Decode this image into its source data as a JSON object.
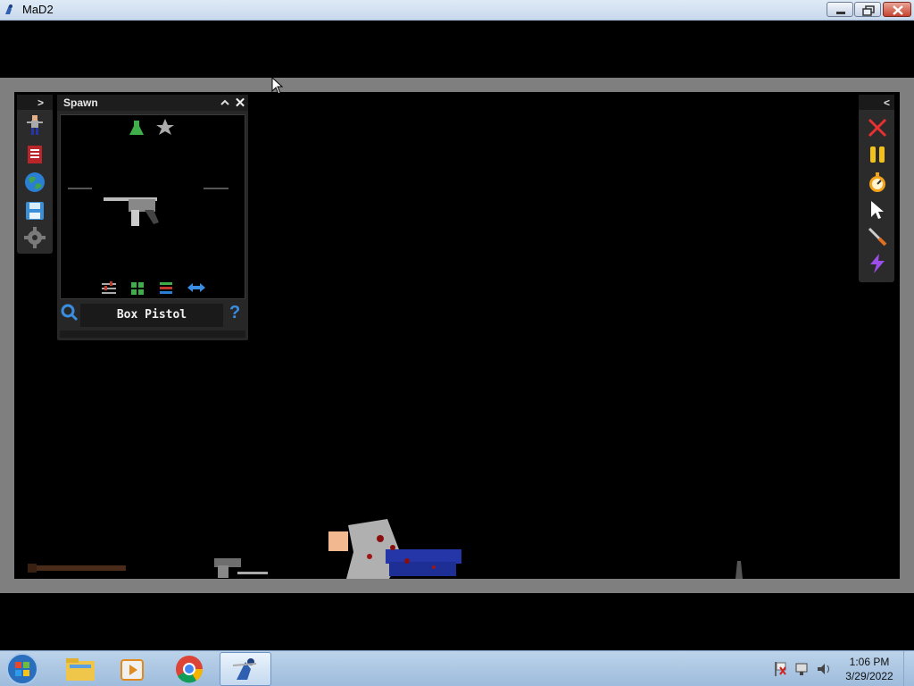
{
  "window": {
    "title": "MaD2",
    "controls": {
      "minimize": "minimize",
      "maximize": "restore",
      "close": "close"
    }
  },
  "left_toolbar": {
    "expand_label": ">",
    "items": [
      "spawn-ragdoll-icon",
      "spawn-menu-icon",
      "world-icon",
      "save-icon",
      "settings-gear-icon"
    ]
  },
  "spawn_panel": {
    "title": "Spawn",
    "collapse_label": "^",
    "close_label": "✕",
    "selected_item": "Box Pistol",
    "categories": [
      "flask-icon",
      "star-icon"
    ],
    "footer_tools": [
      "sliders-icon",
      "grid-icon",
      "list-icon",
      "swap-arrows-icon"
    ],
    "help_label": "?"
  },
  "right_toolbar": {
    "collapse_label": "<",
    "items": [
      "clear-x-icon",
      "pause-icon",
      "stopwatch-icon",
      "pointer-icon",
      "knife-tool-icon",
      "lightning-icon"
    ]
  },
  "taskbar": {
    "pinned": [
      "start-orb",
      "file-explorer-icon",
      "media-player-icon",
      "chrome-icon",
      "mad2-app-icon"
    ],
    "active": "mad2-app-icon",
    "tray": [
      "action-center-flag-icon",
      "network-icon",
      "volume-icon"
    ],
    "time": "1:06 PM",
    "date": "3/29/2022"
  },
  "colors": {
    "frame": "#7f7f7f",
    "panel": "#272727",
    "accent_blue": "#3a8de0",
    "close_red": "#e83030",
    "pause_yellow": "#f2c21b"
  }
}
